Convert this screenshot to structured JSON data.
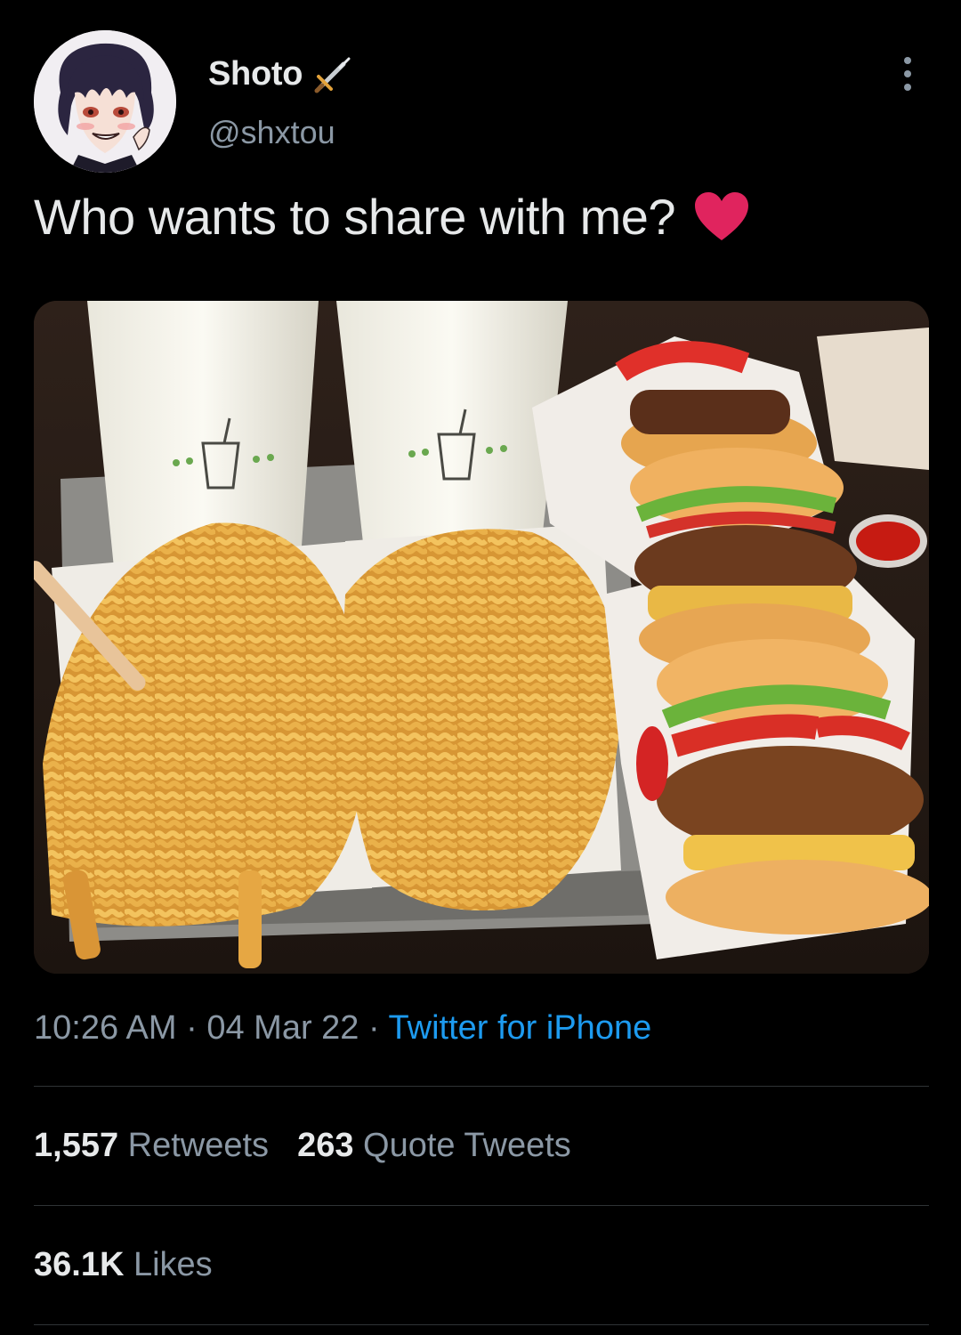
{
  "author": {
    "display_name": "Shoto",
    "handle": "@shxtou",
    "name_emoji_icon": "dagger-icon",
    "avatar_icon": "anime-avatar"
  },
  "tweet": {
    "text": "Who wants to share with me?",
    "emoji_icon": "red-heart-icon",
    "media_description_icon": "burgers-fries-shakes-photo"
  },
  "meta": {
    "time": "10:26 AM",
    "separator1": " · ",
    "date": "04 Mar 22",
    "separator2": " · ",
    "source": "Twitter for iPhone"
  },
  "stats": {
    "retweets_count": "1,557",
    "retweets_label": "Retweets",
    "quotes_count": "263",
    "quotes_label": "Quote Tweets",
    "likes_count": "36.1K",
    "likes_label": "Likes"
  },
  "colors": {
    "background": "#000000",
    "primary_text": "#e7e9ea",
    "secondary_text": "#8b98a5",
    "link": "#1d9bf0",
    "divider": "#2f3336",
    "heart": "#e0245e"
  }
}
